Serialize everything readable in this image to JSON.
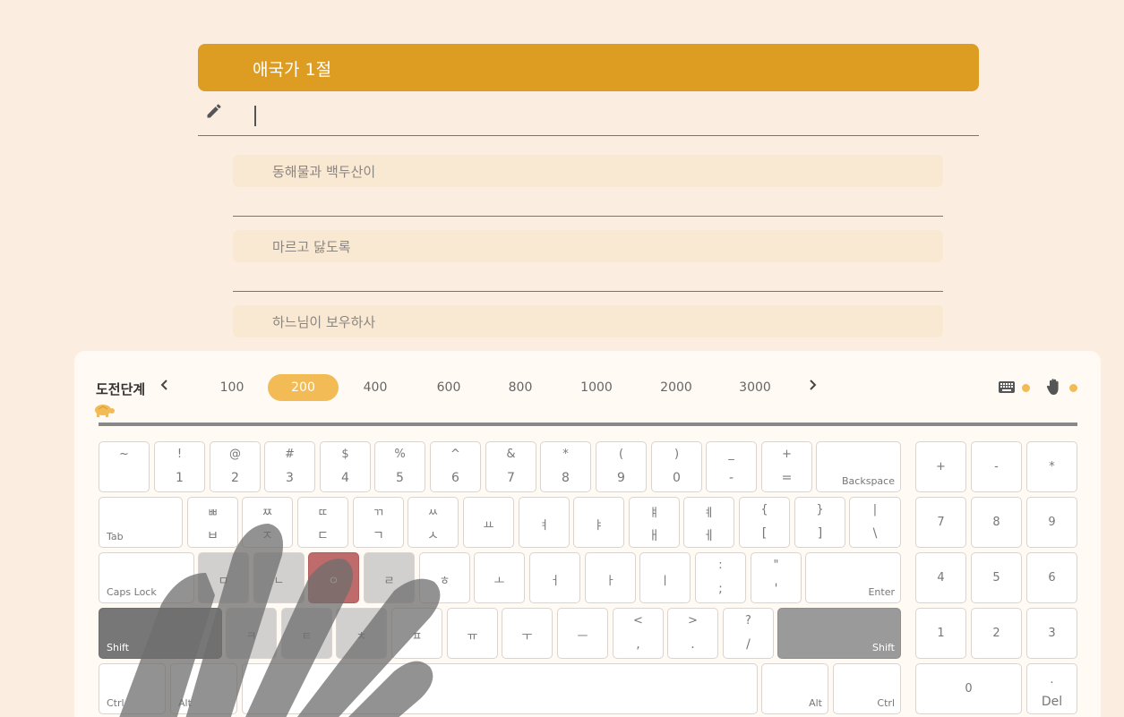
{
  "title": "애국가 1절",
  "lines": [
    "동해물과 백두산이",
    "마르고 닳도록",
    "하느님이 보우하사"
  ],
  "level": {
    "label": "도전단계",
    "options": [
      "100",
      "200",
      "400",
      "600",
      "800",
      "1000",
      "2000",
      "3000"
    ],
    "selected": "200"
  },
  "icons": {
    "pencil": "pencil-icon",
    "keyboard": "keyboard-icon",
    "hand": "hand-icon",
    "turtle": "turtle-icon",
    "prev": "chevron-left-icon",
    "next": "chevron-right-icon"
  },
  "colors": {
    "accent": "#dc9d22",
    "level_active": "#f2bb55",
    "highlight_key": "#c06b6b",
    "background": "#fbeee0"
  },
  "keyboard": {
    "row1": [
      {
        "t": "~",
        "b": ""
      },
      {
        "t": "!",
        "b": "1"
      },
      {
        "t": "@",
        "b": "2"
      },
      {
        "t": "#",
        "b": "3"
      },
      {
        "t": "$",
        "b": "4"
      },
      {
        "t": "%",
        "b": "5"
      },
      {
        "t": "^",
        "b": "6"
      },
      {
        "t": "&",
        "b": "7"
      },
      {
        "t": "*",
        "b": "8"
      },
      {
        "t": "(",
        "b": "9"
      },
      {
        "t": ")",
        "b": "0"
      },
      {
        "t": "_",
        "b": "-"
      },
      {
        "t": "+",
        "b": "="
      }
    ],
    "backspace": "Backspace",
    "tab": "Tab",
    "row2": [
      {
        "t": "ㅃ",
        "b": "ㅂ"
      },
      {
        "t": "ㅉ",
        "b": "ㅈ"
      },
      {
        "t": "ㄸ",
        "b": "ㄷ"
      },
      {
        "t": "ㄲ",
        "b": "ㄱ"
      },
      {
        "t": "ㅆ",
        "b": "ㅅ"
      },
      {
        "c": "ㅛ"
      },
      {
        "c": "ㅕ"
      },
      {
        "c": "ㅑ"
      },
      {
        "t": "ㅒ",
        "b": "ㅐ"
      },
      {
        "t": "ㅖ",
        "b": "ㅔ"
      },
      {
        "t": "{",
        "b": "["
      },
      {
        "t": "}",
        "b": "]"
      },
      {
        "t": "|",
        "b": "\\"
      }
    ],
    "caps_lock": "Caps Lock",
    "row3": [
      {
        "c": "ㅁ"
      },
      {
        "c": "ㄴ"
      },
      {
        "c": "ㅇ"
      },
      {
        "c": "ㄹ"
      },
      {
        "c": "ㅎ"
      },
      {
        "c": "ㅗ"
      },
      {
        "c": "ㅓ"
      },
      {
        "c": "ㅏ"
      },
      {
        "c": "ㅣ"
      },
      {
        "t": ":",
        "b": ";"
      },
      {
        "t": "\"",
        "b": "'"
      }
    ],
    "enter": "Enter",
    "shift": "Shift",
    "row4": [
      {
        "c": "ㅋ"
      },
      {
        "c": "ㅌ"
      },
      {
        "c": "ㅊ"
      },
      {
        "c": "ㅍ"
      },
      {
        "c": "ㅠ"
      },
      {
        "c": "ㅜ"
      },
      {
        "c": "ㅡ"
      },
      {
        "t": "<",
        "b": ","
      },
      {
        "t": ">",
        "b": "."
      },
      {
        "t": "?",
        "b": "/"
      }
    ],
    "ctrl": "Ctrl",
    "alt": "Alt",
    "numpad": {
      "row1": [
        "+",
        "-",
        "*"
      ],
      "row2": [
        "7",
        "8",
        "9"
      ],
      "row3": [
        "4",
        "5",
        "6"
      ],
      "row4": [
        "1",
        "2",
        "3"
      ],
      "zero": "0",
      "del_top": ".",
      "del": "Del"
    }
  }
}
